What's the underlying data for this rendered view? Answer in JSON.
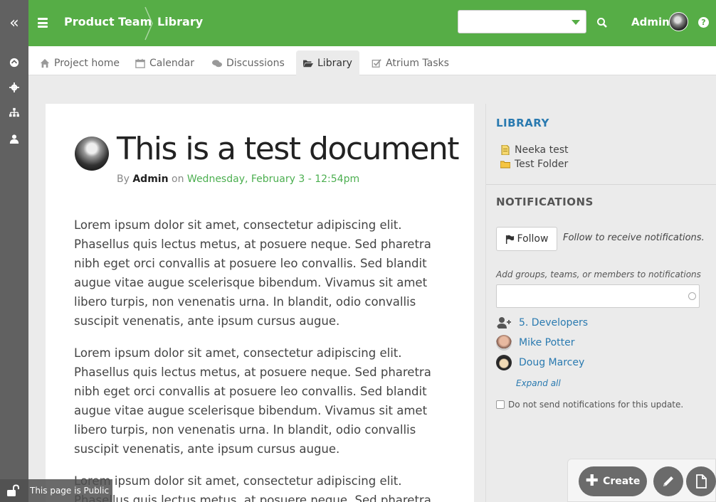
{
  "header": {
    "breadcrumb": [
      "Product Team",
      "Library"
    ],
    "user_name": "Admin",
    "help_label": "?",
    "search_value": ""
  },
  "tabs": [
    {
      "label": "Project home",
      "icon": "home-icon"
    },
    {
      "label": "Calendar",
      "icon": "calendar-icon"
    },
    {
      "label": "Discussions",
      "icon": "comments-icon"
    },
    {
      "label": "Library",
      "icon": "folder-open-icon",
      "active": true
    },
    {
      "label": "Atrium Tasks",
      "icon": "checkbox-icon"
    }
  ],
  "document": {
    "title": "This is a test document",
    "by_prefix": "By",
    "author": "Admin",
    "on_word": "on",
    "date": "Wednesday, February 3 - 12:54pm",
    "paragraphs": [
      "Lorem ipsum dolor sit amet, consectetur adipiscing elit. Phasellus quis lectus metus, at posuere neque. Sed pharetra nibh eget orci convallis at posuere leo convallis. Sed blandit augue vitae augue scelerisque bibendum. Vivamus sit amet libero turpis, non venenatis urna. In blandit, odio convallis suscipit venenatis, ante ipsum cursus augue.",
      "Lorem ipsum dolor sit amet, consectetur adipiscing elit. Phasellus quis lectus metus, at posuere neque. Sed pharetra nibh eget orci convallis at posuere leo convallis. Sed blandit augue vitae augue scelerisque bibendum. Vivamus sit amet libero turpis, non venenatis urna. In blandit, odio convallis suscipit venenatis, ante ipsum cursus augue.",
      "Lorem ipsum dolor sit amet, consectetur adipiscing elit. Phasellus quis lectus metus, at posuere neque. Sed pharetra"
    ]
  },
  "sidebar": {
    "library_heading": "LIBRARY",
    "library_items": [
      {
        "label": "Neeka test",
        "icon": "document-icon"
      },
      {
        "label": "Test Folder",
        "icon": "folder-icon"
      }
    ],
    "notifications_heading": "NOTIFICATIONS",
    "follow_label": "Follow",
    "follow_hint": "Follow to receive notifications.",
    "add_label": "Add groups, teams, or members to notifications",
    "add_value": "",
    "members": [
      {
        "label": "5. Developers",
        "icon": "add-user-icon"
      },
      {
        "label": "Mike Potter",
        "icon": "avatar"
      },
      {
        "label": "Doug Marcey",
        "icon": "avatar"
      }
    ],
    "expand_all": "Expand all",
    "no_send_label": "Do not send notifications for this update.",
    "no_send_checked": false
  },
  "actions": {
    "create_label": "Create"
  },
  "status": {
    "public_label": "This page is Public"
  },
  "colors": {
    "brand_green": "#56ad46",
    "link_blue": "#2a7ab0",
    "date_green": "#4caf50",
    "rail_gray": "#616161"
  }
}
